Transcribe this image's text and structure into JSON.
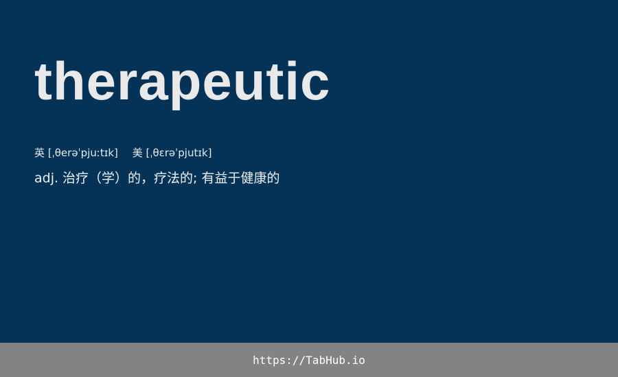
{
  "word": "therapeutic",
  "pronunciation": {
    "uk": "英 [ˌθerəˈpjuːtɪk]",
    "us": "美 [ˌθɛrəˈpjutɪk]"
  },
  "definition": "adj. 治疗（学）的，疗法的; 有益于健康的",
  "footer": {
    "link_text": "https://TabHub.io"
  },
  "colors": {
    "background": "#053357",
    "footer_background": "#838384",
    "word_text": "#e9e9ea"
  }
}
